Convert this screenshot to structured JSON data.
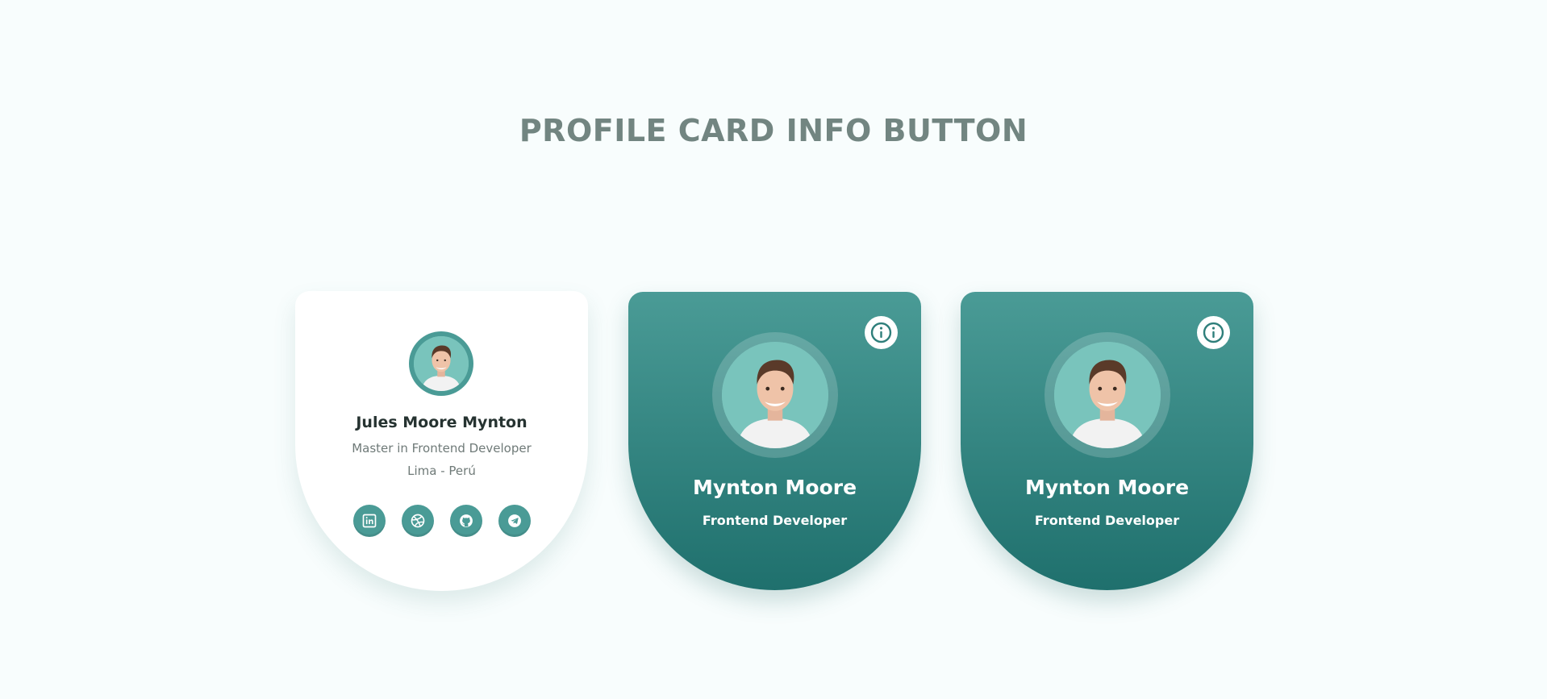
{
  "page": {
    "title": "PROFILE CARD INFO BUTTON"
  },
  "colors": {
    "background": "#f8fdfd",
    "title": "#728581",
    "accent": "#4a9b96",
    "accent_dark": "#1f706d",
    "avatar_bg": "#79c4bc"
  },
  "card_open": {
    "name": "Jules Moore Mynton",
    "role": "Master in Frontend Developer",
    "location": "Lima - Perú",
    "socials": [
      {
        "icon": "linkedin-icon"
      },
      {
        "icon": "dribbble-icon"
      },
      {
        "icon": "github-icon"
      },
      {
        "icon": "telegram-icon"
      }
    ]
  },
  "cards_closed": [
    {
      "name": "Mynton Moore",
      "role": "Frontend Developer",
      "info_icon": "info-icon"
    },
    {
      "name": "Mynton Moore",
      "role": "Frontend Developer",
      "info_icon": "info-icon"
    }
  ]
}
